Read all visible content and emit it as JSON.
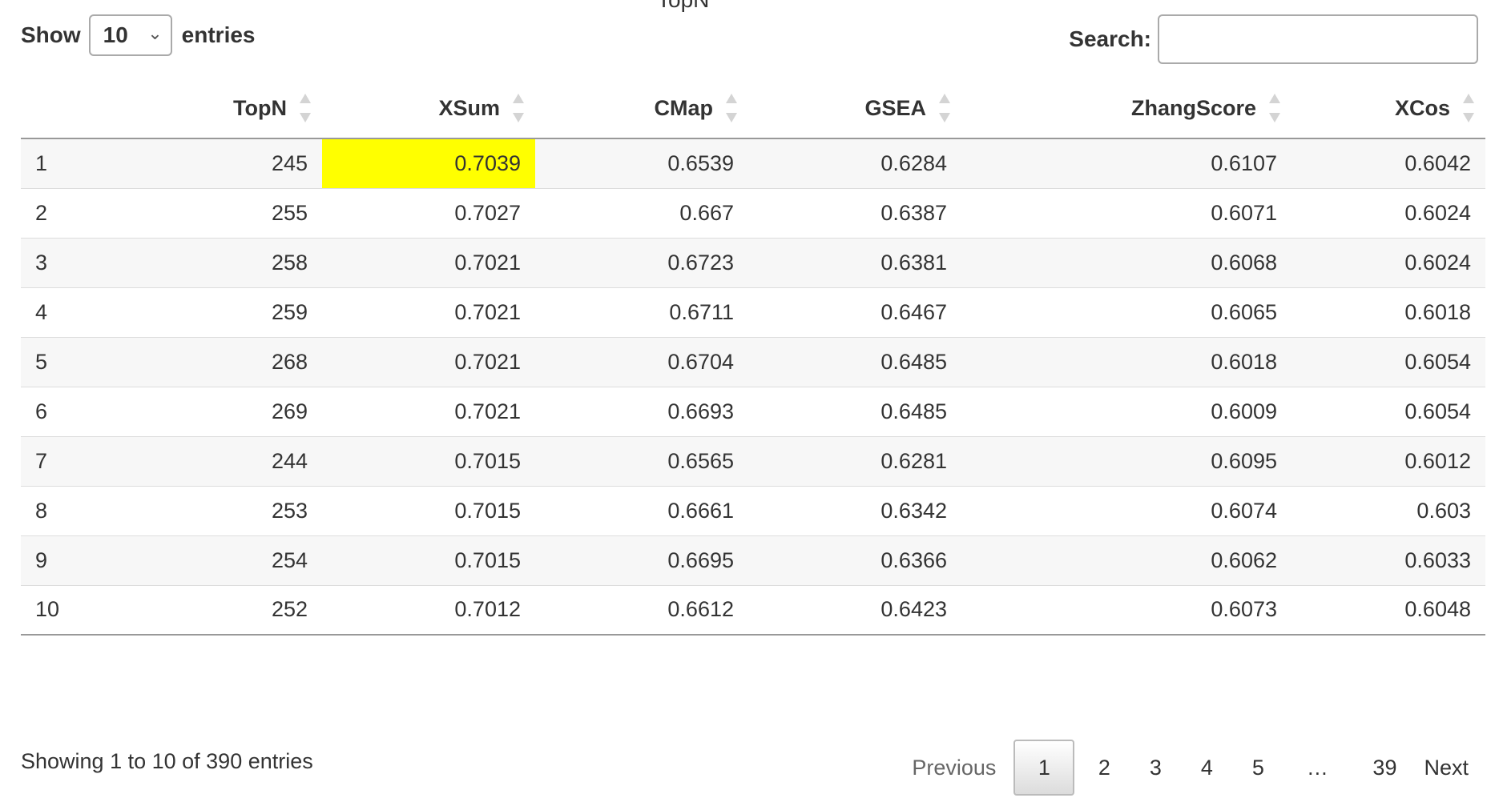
{
  "caption": "TopN",
  "controls": {
    "show_label": "Show",
    "entries_label": "entries",
    "length_value": "10",
    "search_label": "Search:",
    "search_value": ""
  },
  "table": {
    "headers": [
      "TopN",
      "XSum",
      "CMap",
      "GSEA",
      "ZhangScore",
      "XCos"
    ],
    "rows": [
      {
        "index": "1",
        "cells": [
          "245",
          "0.7039",
          "0.6539",
          "0.6284",
          "0.6107",
          "0.6042"
        ]
      },
      {
        "index": "2",
        "cells": [
          "255",
          "0.7027",
          "0.667",
          "0.6387",
          "0.6071",
          "0.6024"
        ]
      },
      {
        "index": "3",
        "cells": [
          "258",
          "0.7021",
          "0.6723",
          "0.6381",
          "0.6068",
          "0.6024"
        ]
      },
      {
        "index": "4",
        "cells": [
          "259",
          "0.7021",
          "0.6711",
          "0.6467",
          "0.6065",
          "0.6018"
        ]
      },
      {
        "index": "5",
        "cells": [
          "268",
          "0.7021",
          "0.6704",
          "0.6485",
          "0.6018",
          "0.6054"
        ]
      },
      {
        "index": "6",
        "cells": [
          "269",
          "0.7021",
          "0.6693",
          "0.6485",
          "0.6009",
          "0.6054"
        ]
      },
      {
        "index": "7",
        "cells": [
          "244",
          "0.7015",
          "0.6565",
          "0.6281",
          "0.6095",
          "0.6012"
        ]
      },
      {
        "index": "8",
        "cells": [
          "253",
          "0.7015",
          "0.6661",
          "0.6342",
          "0.6074",
          "0.603"
        ]
      },
      {
        "index": "9",
        "cells": [
          "254",
          "0.7015",
          "0.6695",
          "0.6366",
          "0.6062",
          "0.6033"
        ]
      },
      {
        "index": "10",
        "cells": [
          "252",
          "0.7012",
          "0.6612",
          "0.6423",
          "0.6073",
          "0.6048"
        ]
      }
    ],
    "highlight_color": "#ffff00"
  },
  "footer": {
    "info": "Showing 1 to 10 of 390 entries",
    "previous": "Previous",
    "pages": [
      "1",
      "2",
      "3",
      "4",
      "5",
      "…",
      "39"
    ],
    "current_page": "1",
    "next": "Next"
  }
}
